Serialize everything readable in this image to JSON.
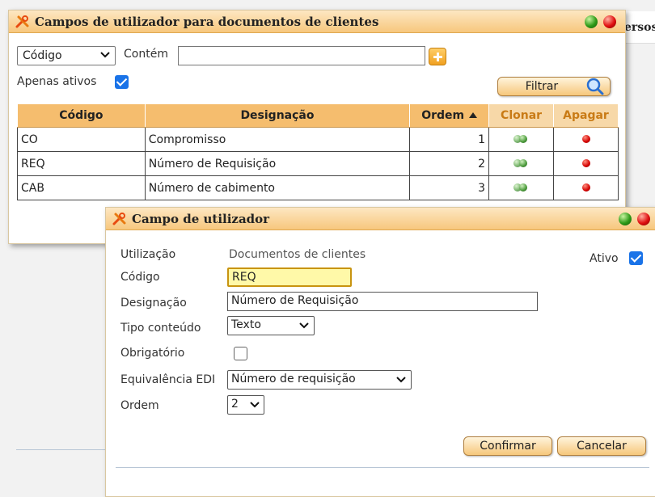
{
  "background": {
    "partial_title": "ersos"
  },
  "list_dialog": {
    "title": "Campos de utilizador para documentos de clientes",
    "filter_field": "Código",
    "filter_operator": "Contém",
    "filter_value": "",
    "only_active_label": "Apenas ativos",
    "only_active_checked": true,
    "filter_button": "Filtrar",
    "columns": [
      "Código",
      "Designação",
      "Ordem",
      "Clonar",
      "Apagar"
    ],
    "rows": [
      {
        "code": "CO",
        "name": "Compromisso",
        "order": "1"
      },
      {
        "code": "REQ",
        "name": "Número de Requisição",
        "order": "2"
      },
      {
        "code": "CAB",
        "name": "Número de cabimento",
        "order": "3"
      }
    ]
  },
  "edit_dialog": {
    "title": "Campo de utilizador",
    "usage_label": "Utilização",
    "usage_value": "Documentos de clientes",
    "active_label": "Ativo",
    "active_checked": true,
    "code_label": "Código",
    "code_value": "REQ",
    "name_label": "Designação",
    "name_value": "Número de Requisição",
    "content_type_label": "Tipo conteúdo",
    "content_type_value": "Texto",
    "mandatory_label": "Obrigatório",
    "mandatory_checked": false,
    "edi_label": "Equivalência EDI",
    "edi_value": "Número de requisição",
    "order_label": "Ordem",
    "order_value": "2",
    "confirm_button": "Confirmar",
    "cancel_button": "Cancelar"
  },
  "colors": {
    "titlebar": "#f7c77d",
    "header": "#f5bd6e",
    "checkbox": "#1a73e8",
    "focus_field": "#fff9a8"
  }
}
